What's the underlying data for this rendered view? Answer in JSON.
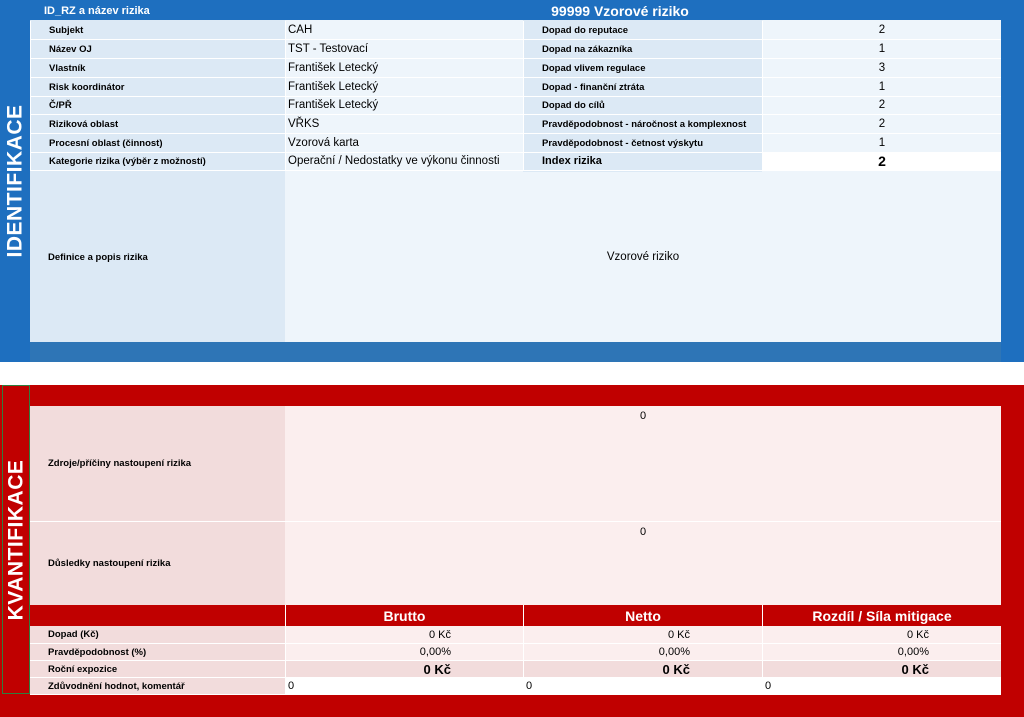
{
  "identification": {
    "vertical_label": "IDENTIFIKACE",
    "header_label": "ID_RZ a název rizika",
    "header_title": "99999 Vzorové riziko",
    "rows": [
      {
        "label": "Subjekt",
        "value": "CAH",
        "impact_label": "Dopad do reputace",
        "impact_value": "2"
      },
      {
        "label": "Název OJ",
        "value": "TST - Testovací",
        "impact_label": "Dopad na zákazníka",
        "impact_value": "1"
      },
      {
        "label": "Vlastník",
        "value": "František Letecký",
        "impact_label": "Dopad vlivem regulace",
        "impact_value": "3"
      },
      {
        "label": "Risk koordinátor",
        "value": "František Letecký",
        "impact_label": "Dopad - finanční ztráta",
        "impact_value": "1"
      },
      {
        "label": "Č/PŘ",
        "value": "František Letecký",
        "impact_label": "Dopad do cílů",
        "impact_value": "2"
      },
      {
        "label": "Riziková oblast",
        "value": "VŘKS",
        "impact_label": "Pravděpodobnost - náročnost a komplexnost",
        "impact_value": "2"
      },
      {
        "label": "Procesní oblast (činnost)",
        "value": "Vzorová karta",
        "impact_label": "Pravděpodobnost - četnost výskytu",
        "impact_value": "1"
      },
      {
        "label": "Kategorie rizika (výběr z možností)",
        "value": "Operační / Nedostatky ve výkonu činnosti",
        "impact_label": "Index rizika",
        "impact_value": "2"
      }
    ],
    "definition_label": "Definice a popis rizika",
    "definition_value": "Vzorové riziko"
  },
  "quantification": {
    "vertical_label": "KVANTIFIKACE",
    "sources_label": "Zdroje/příčiny nastoupení rizika",
    "sources_value": "0",
    "consequences_label": "Důsledky nastoupení rizika",
    "consequences_value": "0",
    "columns": [
      "Brutto",
      "Netto",
      "Rozdíl / Síla mitigace"
    ],
    "rows": [
      {
        "label": "Dopad (Kč)",
        "values": [
          "0 Kč",
          "0 Kč",
          "0 Kč"
        ]
      },
      {
        "label": "Pravděpodobnost (%)",
        "values": [
          "0,00%",
          "0,00%",
          "0,00%"
        ]
      },
      {
        "label": "Roční expozice",
        "values": [
          "0 Kč",
          "0 Kč",
          "0 Kč"
        ]
      },
      {
        "label": "Zdůvodnění hodnot, komentář",
        "values": [
          "0",
          "0",
          "0"
        ]
      }
    ]
  },
  "colors": {
    "blue": "#1e6fbf",
    "red": "#c00000",
    "light_blue": "#dce9f5",
    "light_red": "#f2dcdc"
  }
}
